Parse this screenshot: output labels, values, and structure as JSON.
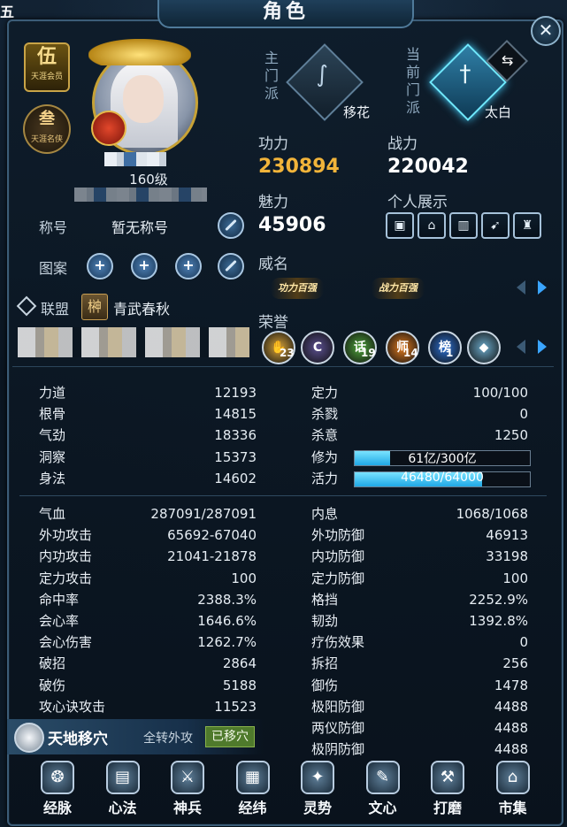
{
  "window": {
    "title": "角色",
    "corner_label": "五",
    "close_glyph": "✕"
  },
  "profile": {
    "vip_badge_main": "伍",
    "vip_badge_sub": "天涯会员",
    "title_badge_main": "叁",
    "title_badge_sub": "天涯名侠",
    "level": "160级",
    "title_label": "称号",
    "title_value": "暂无称号",
    "pattern_label": "图案",
    "alliance_label": "联盟",
    "alliance_icon": "榊",
    "alliance_name": "青武春秋"
  },
  "sects": {
    "main_label": "主门派",
    "main_name": "移花",
    "current_label": "当前门派",
    "current_name": "太白",
    "swap_glyph": "⇆"
  },
  "power": {
    "gongli_label": "功力",
    "gongli_value": "230894",
    "zhanli_label": "战力",
    "zhanli_value": "220042",
    "meili_label": "魅力",
    "meili_value": "45906",
    "personal_label": "个人展示",
    "weiming_label": "威名",
    "fame_tags": [
      "功力百强",
      "战力百强"
    ],
    "honor_label": "荣誉",
    "honors": [
      {
        "icon": "hand-icon",
        "glyph": "✋",
        "count": "23",
        "color": "#d9a43a"
      },
      {
        "icon": "c-medal-icon",
        "glyph": "C",
        "count": "",
        "color": "#5a4f8f"
      },
      {
        "icon": "talk-icon",
        "glyph": "话",
        "count": "19",
        "color": "#4da33a"
      },
      {
        "icon": "master-icon",
        "glyph": "师",
        "count": "14",
        "color": "#e07a1e"
      },
      {
        "icon": "rank-icon",
        "glyph": "榜",
        "count": "1",
        "color": "#2b6fd1"
      },
      {
        "icon": "orb-icon",
        "glyph": "◆",
        "count": "",
        "color": "#6aa8c8"
      }
    ]
  },
  "attributes_left": [
    {
      "label": "力道",
      "value": "12193"
    },
    {
      "label": "根骨",
      "value": "14815"
    },
    {
      "label": "气劲",
      "value": "18336"
    },
    {
      "label": "洞察",
      "value": "15373"
    },
    {
      "label": "身法",
      "value": "14602"
    }
  ],
  "attributes_right": [
    {
      "label": "定力",
      "value": "100/100"
    },
    {
      "label": "杀戮",
      "value": "0"
    },
    {
      "label": "杀意",
      "value": "1250"
    }
  ],
  "bars": [
    {
      "label": "修为",
      "text": "61亿/300亿",
      "fraction": 0.203
    },
    {
      "label": "活力",
      "text": "46480/64000",
      "fraction": 0.726
    }
  ],
  "combat_left": [
    {
      "label": "气血",
      "value": "287091/287091"
    },
    {
      "label": "外功攻击",
      "value": "65692-67040"
    },
    {
      "label": "内功攻击",
      "value": "21041-21878"
    },
    {
      "label": "定力攻击",
      "value": "100"
    },
    {
      "label": "命中率",
      "value": "2388.3%"
    },
    {
      "label": "会心率",
      "value": "1646.6%"
    },
    {
      "label": "会心伤害",
      "value": "1262.7%"
    },
    {
      "label": "破招",
      "value": "2864"
    },
    {
      "label": "破伤",
      "value": "5188"
    },
    {
      "label": "攻心诀攻击",
      "value": "11523"
    }
  ],
  "combat_right": [
    {
      "label": "内息",
      "value": "1068/1068"
    },
    {
      "label": "外功防御",
      "value": "46913"
    },
    {
      "label": "内功防御",
      "value": "33198"
    },
    {
      "label": "定力防御",
      "value": "100"
    },
    {
      "label": "格挡",
      "value": "2252.9%"
    },
    {
      "label": "韧劲",
      "value": "1392.8%"
    },
    {
      "label": "疗伤效果",
      "value": "0"
    },
    {
      "label": "拆招",
      "value": "256"
    },
    {
      "label": "御伤",
      "value": "1478"
    },
    {
      "label": "极阳防御",
      "value": "4488"
    },
    {
      "label": "两仪防御",
      "value": "4488"
    },
    {
      "label": "极阴防御",
      "value": "4488"
    }
  ],
  "relocation": {
    "title": "天地移穴",
    "subtitle": "全转外攻",
    "status": "已移穴"
  },
  "nav": [
    {
      "label": "经脉",
      "icon": "meridian-icon",
      "glyph": "❂"
    },
    {
      "label": "心法",
      "icon": "book-icon",
      "glyph": "▤"
    },
    {
      "label": "神兵",
      "icon": "weapon-icon",
      "glyph": "⚔"
    },
    {
      "label": "经纬",
      "icon": "grid-icon",
      "glyph": "▦"
    },
    {
      "label": "灵势",
      "icon": "spirit-icon",
      "glyph": "✦"
    },
    {
      "label": "文心",
      "icon": "brush-icon",
      "glyph": "✎"
    },
    {
      "label": "打磨",
      "icon": "hammer-icon",
      "glyph": "⚒"
    },
    {
      "label": "市集",
      "icon": "market-icon",
      "glyph": "⌂"
    }
  ]
}
